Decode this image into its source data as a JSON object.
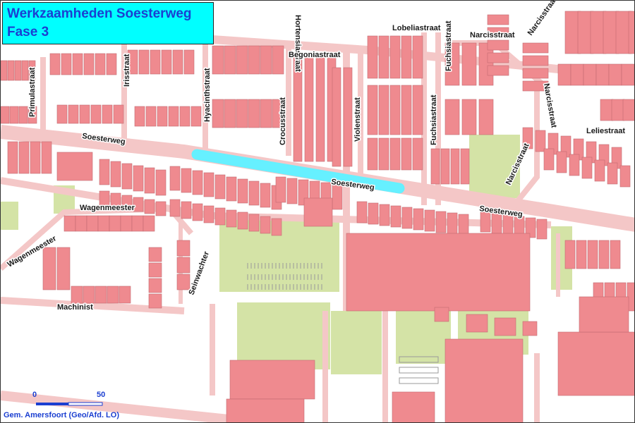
{
  "title": {
    "line1": "Werkzaamheden Soesterweg",
    "line2": "Fase 3"
  },
  "colors": {
    "building": "#ef8a8f",
    "building_outline": "#c26b70",
    "road": "#f4c7c7",
    "green": "#d4e3a6",
    "highlight": "#66f0ff",
    "title_bg": "#00ffff",
    "title_text": "#1b3fd1"
  },
  "streets": [
    "Hortensiastraat",
    "Lobeliastraat",
    "Narcisstraat",
    "Narcisstraat",
    "Narcisstraat",
    "Begoniastraat",
    "Primulastraat",
    "Irisstraat",
    "Hyacinthstraat",
    "Crocusstraat",
    "Violenstraat",
    "Fuchsiastraat",
    "Fuchsiastraat",
    "Leliestraat",
    "Soesterweg",
    "Soesterweg",
    "Soesterweg",
    "Narcisstraat",
    "Wagenmeester",
    "Wagenmeester",
    "Seinwachter",
    "Machinist"
  ],
  "scale_bar": {
    "start_label": "0",
    "end_label": "50",
    "value": 50
  },
  "credit": "Gem. Amersfoort (Geo/Afd. LO)"
}
